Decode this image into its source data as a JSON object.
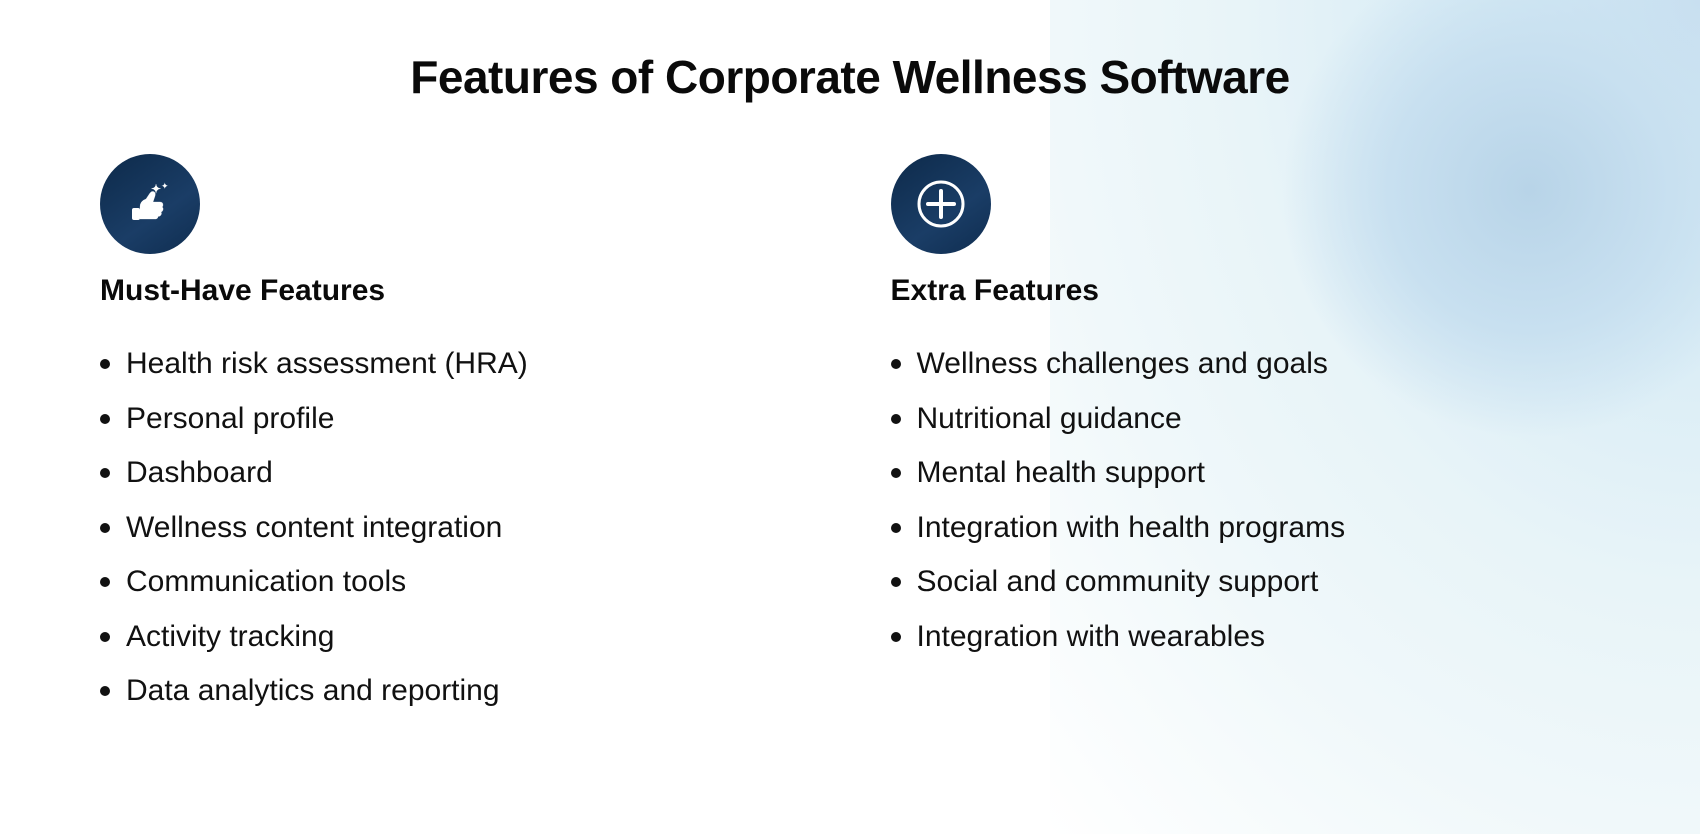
{
  "page": {
    "title": "Features of Corporate Wellness Software"
  },
  "left_column": {
    "icon": "thumbs-up-star-icon",
    "heading": "Must-Have Features",
    "items": [
      "Health risk assessment (HRA)",
      "Personal profile",
      "Dashboard",
      "Wellness content integration",
      "Communication tools",
      "Activity tracking",
      "Data analytics and reporting"
    ]
  },
  "right_column": {
    "icon": "plus-circle-icon",
    "heading": "Extra Features",
    "items": [
      "Wellness challenges and goals",
      "Nutritional guidance",
      "Mental health support",
      "Integration with health programs",
      "Social and community support",
      "Integration with wearables"
    ]
  }
}
